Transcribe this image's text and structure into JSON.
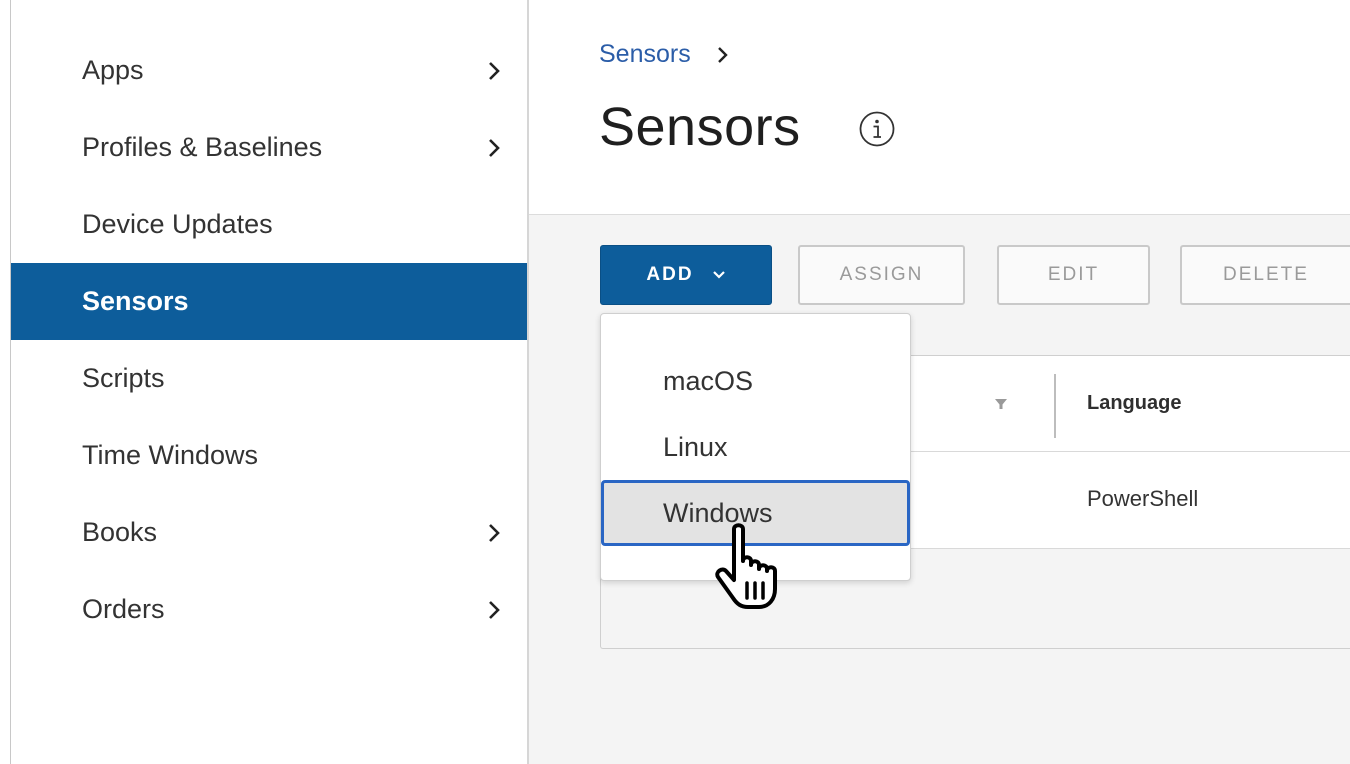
{
  "sidebar": {
    "items": [
      {
        "label": "Apps",
        "has_chevron": true
      },
      {
        "label": "Profiles & Baselines",
        "has_chevron": true
      },
      {
        "label": "Device Updates",
        "has_chevron": false
      },
      {
        "label": "Sensors",
        "has_chevron": false,
        "active": true
      },
      {
        "label": "Scripts",
        "has_chevron": false
      },
      {
        "label": "Time Windows",
        "has_chevron": false
      },
      {
        "label": "Books",
        "has_chevron": true
      },
      {
        "label": "Orders",
        "has_chevron": true
      }
    ]
  },
  "header": {
    "breadcrumb": "Sensors",
    "title": "Sensors",
    "info_icon": "info-icon"
  },
  "toolbar": {
    "add_label": "ADD",
    "assign_label": "ASSIGN",
    "edit_label": "EDIT",
    "delete_label": "DELETE"
  },
  "add_menu": {
    "items": [
      "macOS",
      "Linux",
      "Windows"
    ],
    "selected": "Windows"
  },
  "grid": {
    "columns": [
      "Language"
    ],
    "rows": [
      {
        "language": "PowerShell"
      }
    ]
  },
  "colors": {
    "primary": "#0d5d9b",
    "link": "#2b5da8",
    "focus": "#2a66c4"
  },
  "cursor": "hand-pointer-icon"
}
